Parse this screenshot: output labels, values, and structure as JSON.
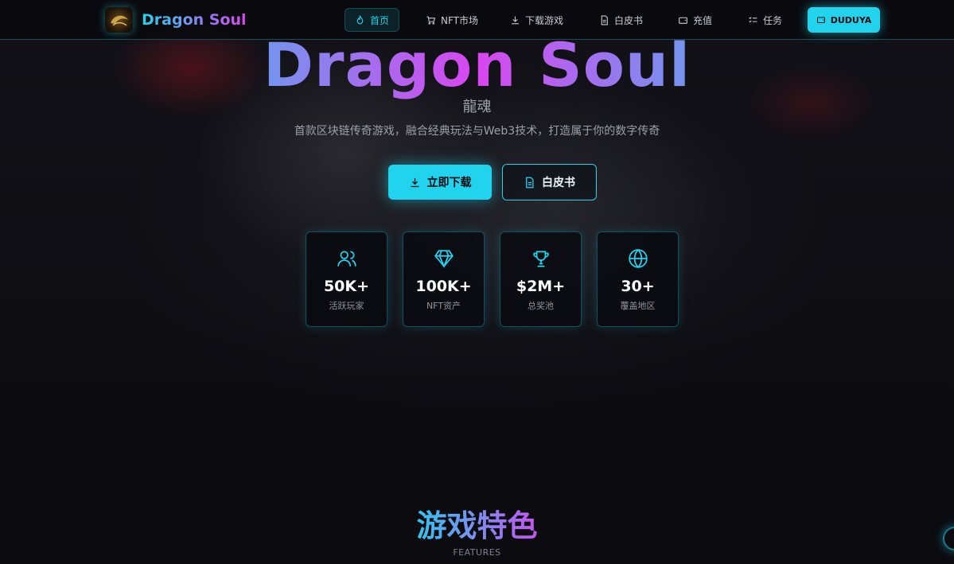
{
  "nav": {
    "brand": "Dragon Soul",
    "logo_text": "Dragon Soul",
    "items": [
      {
        "label": "首页",
        "icon": "flame-icon",
        "active": true
      },
      {
        "label": "NFT市场",
        "icon": "cart-icon",
        "active": false
      },
      {
        "label": "下载游戏",
        "icon": "download-icon",
        "active": false
      },
      {
        "label": "白皮书",
        "icon": "document-icon",
        "active": false
      },
      {
        "label": "充值",
        "icon": "wallet-icon",
        "active": false
      },
      {
        "label": "任务",
        "icon": "checklist-icon",
        "active": false
      }
    ],
    "wallet_label": "DUDUYA"
  },
  "hero": {
    "title": "Dragon Soul",
    "subtitle": "龍魂",
    "description": "首款区块链传奇游戏，融合经典玩法与Web3技术，打造属于你的数字传奇",
    "download_label": "立即下载",
    "whitepaper_label": "白皮书"
  },
  "stats": [
    {
      "value": "50K+",
      "label": "活跃玩家",
      "icon": "users-icon"
    },
    {
      "value": "100K+",
      "label": "NFT资产",
      "icon": "gem-icon"
    },
    {
      "value": "$2M+",
      "label": "总奖池",
      "icon": "trophy-icon"
    },
    {
      "value": "30+",
      "label": "覆盖地区",
      "icon": "globe-icon"
    }
  ],
  "features": {
    "title": "游戏特色",
    "subtitle": "FEATURES"
  },
  "colors": {
    "accent": "#22d3ee",
    "accent2": "#d946ef",
    "background": "#0b0b10"
  }
}
